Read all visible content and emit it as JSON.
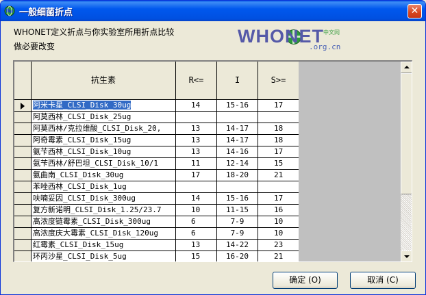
{
  "window": {
    "title": "一般细菌折点",
    "close_glyph": "✕"
  },
  "message": {
    "line1": "WHONET定义折点与你实验室所用折点比较",
    "line2": "做必要改变"
  },
  "logo": {
    "main": "WHONET",
    "sub": ".org.cn",
    "cn": "中文网"
  },
  "table": {
    "columns": [
      "抗生素",
      "R<=",
      "I",
      "S>="
    ],
    "rows": [
      {
        "name": "阿米卡星_CLSI_Disk_30ug",
        "r": "14",
        "i": "15-16",
        "s": "17",
        "selected": true
      },
      {
        "name": "阿莫西林_CLSI_Disk_25ug",
        "r": "",
        "i": "",
        "s": ""
      },
      {
        "name": "阿莫西林/克拉维酸_CLSI_Disk_20,",
        "r": "13",
        "i": "14-17",
        "s": "18"
      },
      {
        "name": "阿奇霉素_CLSI_Disk_15ug",
        "r": "13",
        "i": "14-17",
        "s": "18"
      },
      {
        "name": "氨苄西林_CLSI_Disk_10ug",
        "r": "13",
        "i": "14-16",
        "s": "17"
      },
      {
        "name": "氨苄西林/舒巴坦_CLSI_Disk_10/1",
        "r": "11",
        "i": "12-14",
        "s": "15"
      },
      {
        "name": "氨曲南_CLSI_Disk_30ug",
        "r": "17",
        "i": "18-20",
        "s": "21"
      },
      {
        "name": "苯唑西林_CLSI_Disk_1ug",
        "r": "",
        "i": "",
        "s": ""
      },
      {
        "name": "呋喃妥因_CLSI_Disk_300ug",
        "r": "14",
        "i": "15-16",
        "s": "17"
      },
      {
        "name": "复方新诺明_CLSI_Disk_1.25/23.7",
        "r": "10",
        "i": "11-15",
        "s": "16"
      },
      {
        "name": "高浓度链霉素_CLSI_Disk_300ug",
        "r": "6",
        "i": "7-9",
        "s": "10"
      },
      {
        "name": "高浓度庆大霉素_CLSI_Disk_120ug",
        "r": "6",
        "i": "7-9",
        "s": "10"
      },
      {
        "name": "红霉素_CLSI_Disk_15ug",
        "r": "13",
        "i": "14-22",
        "s": "23"
      },
      {
        "name": "环丙沙星_CLSI_Disk_5ug",
        "r": "15",
        "i": "16-20",
        "s": "21"
      }
    ]
  },
  "buttons": {
    "ok": "确定 (O)",
    "cancel": "取消 (C)"
  },
  "icons": {
    "app": "globe-icon",
    "row_pointer": "row-pointer-icon",
    "scroll_up": "scroll-up-icon",
    "scroll_down": "scroll-down-icon"
  },
  "colors": {
    "titlebar": "#0058ee",
    "selection": "#316ac5",
    "window_bg": "#ece9d8",
    "close_button": "#d8451e"
  }
}
